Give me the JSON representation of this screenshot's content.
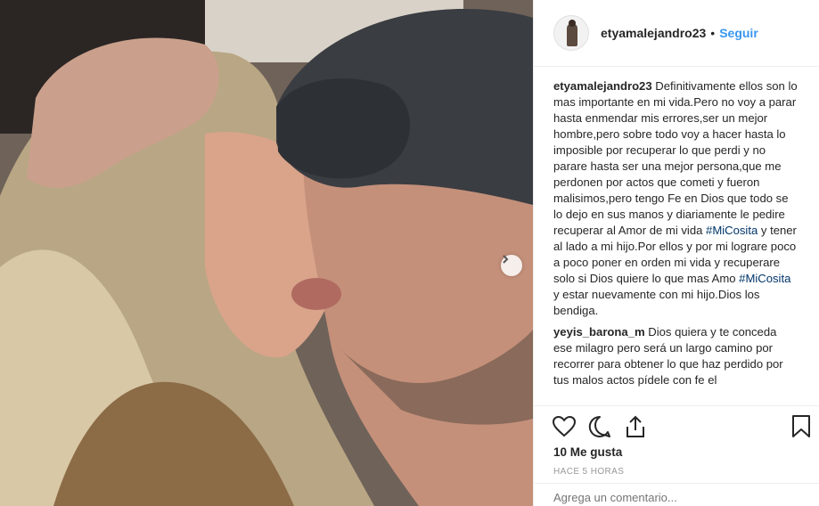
{
  "post": {
    "username": "etyamalejandro23",
    "follow_label": "Seguir",
    "separator": "•"
  },
  "comments": [
    {
      "user": "etyamalejandro23",
      "text_1": "Definitivamente ellos son lo mas importante en mi vida.Pero no voy a parar hasta enmendar mis errores,ser un mejor hombre,pero sobre todo voy a hacer hasta lo imposible por recuperar lo que perdi y no parare hasta ser una mejor persona,que me perdonen por actos que cometi y fueron malisimos,pero tengo Fe en Dios que todo se lo dejo en sus manos y diariamente le pedire recuperar al Amor de mi vida ",
      "tag_1": "#MiCosita",
      "text_2": " y tener al lado a mi hijo.Por ellos y por mi lograre poco a poco poner en orden mi vida y recuperare solo si Dios quiere lo que mas Amo ",
      "tag_2": "#MiCosita",
      "text_3": " y estar nuevamente con mi hijo.Dios los bendiga."
    },
    {
      "user": "yeyis_barona_m",
      "text": "Dios quiera y te conceda ese milagro pero será un largo camino por recorrer para obtener lo que haz perdido por tus malos actos pídele con fe el"
    }
  ],
  "likes": "10 Me gusta",
  "time": "HACE 5 HORAS",
  "add_comment_placeholder": "Agrega un comentario...",
  "icons": [
    "heart-icon",
    "comment-icon",
    "share-icon",
    "bookmark-icon",
    "chevron-right-icon"
  ]
}
